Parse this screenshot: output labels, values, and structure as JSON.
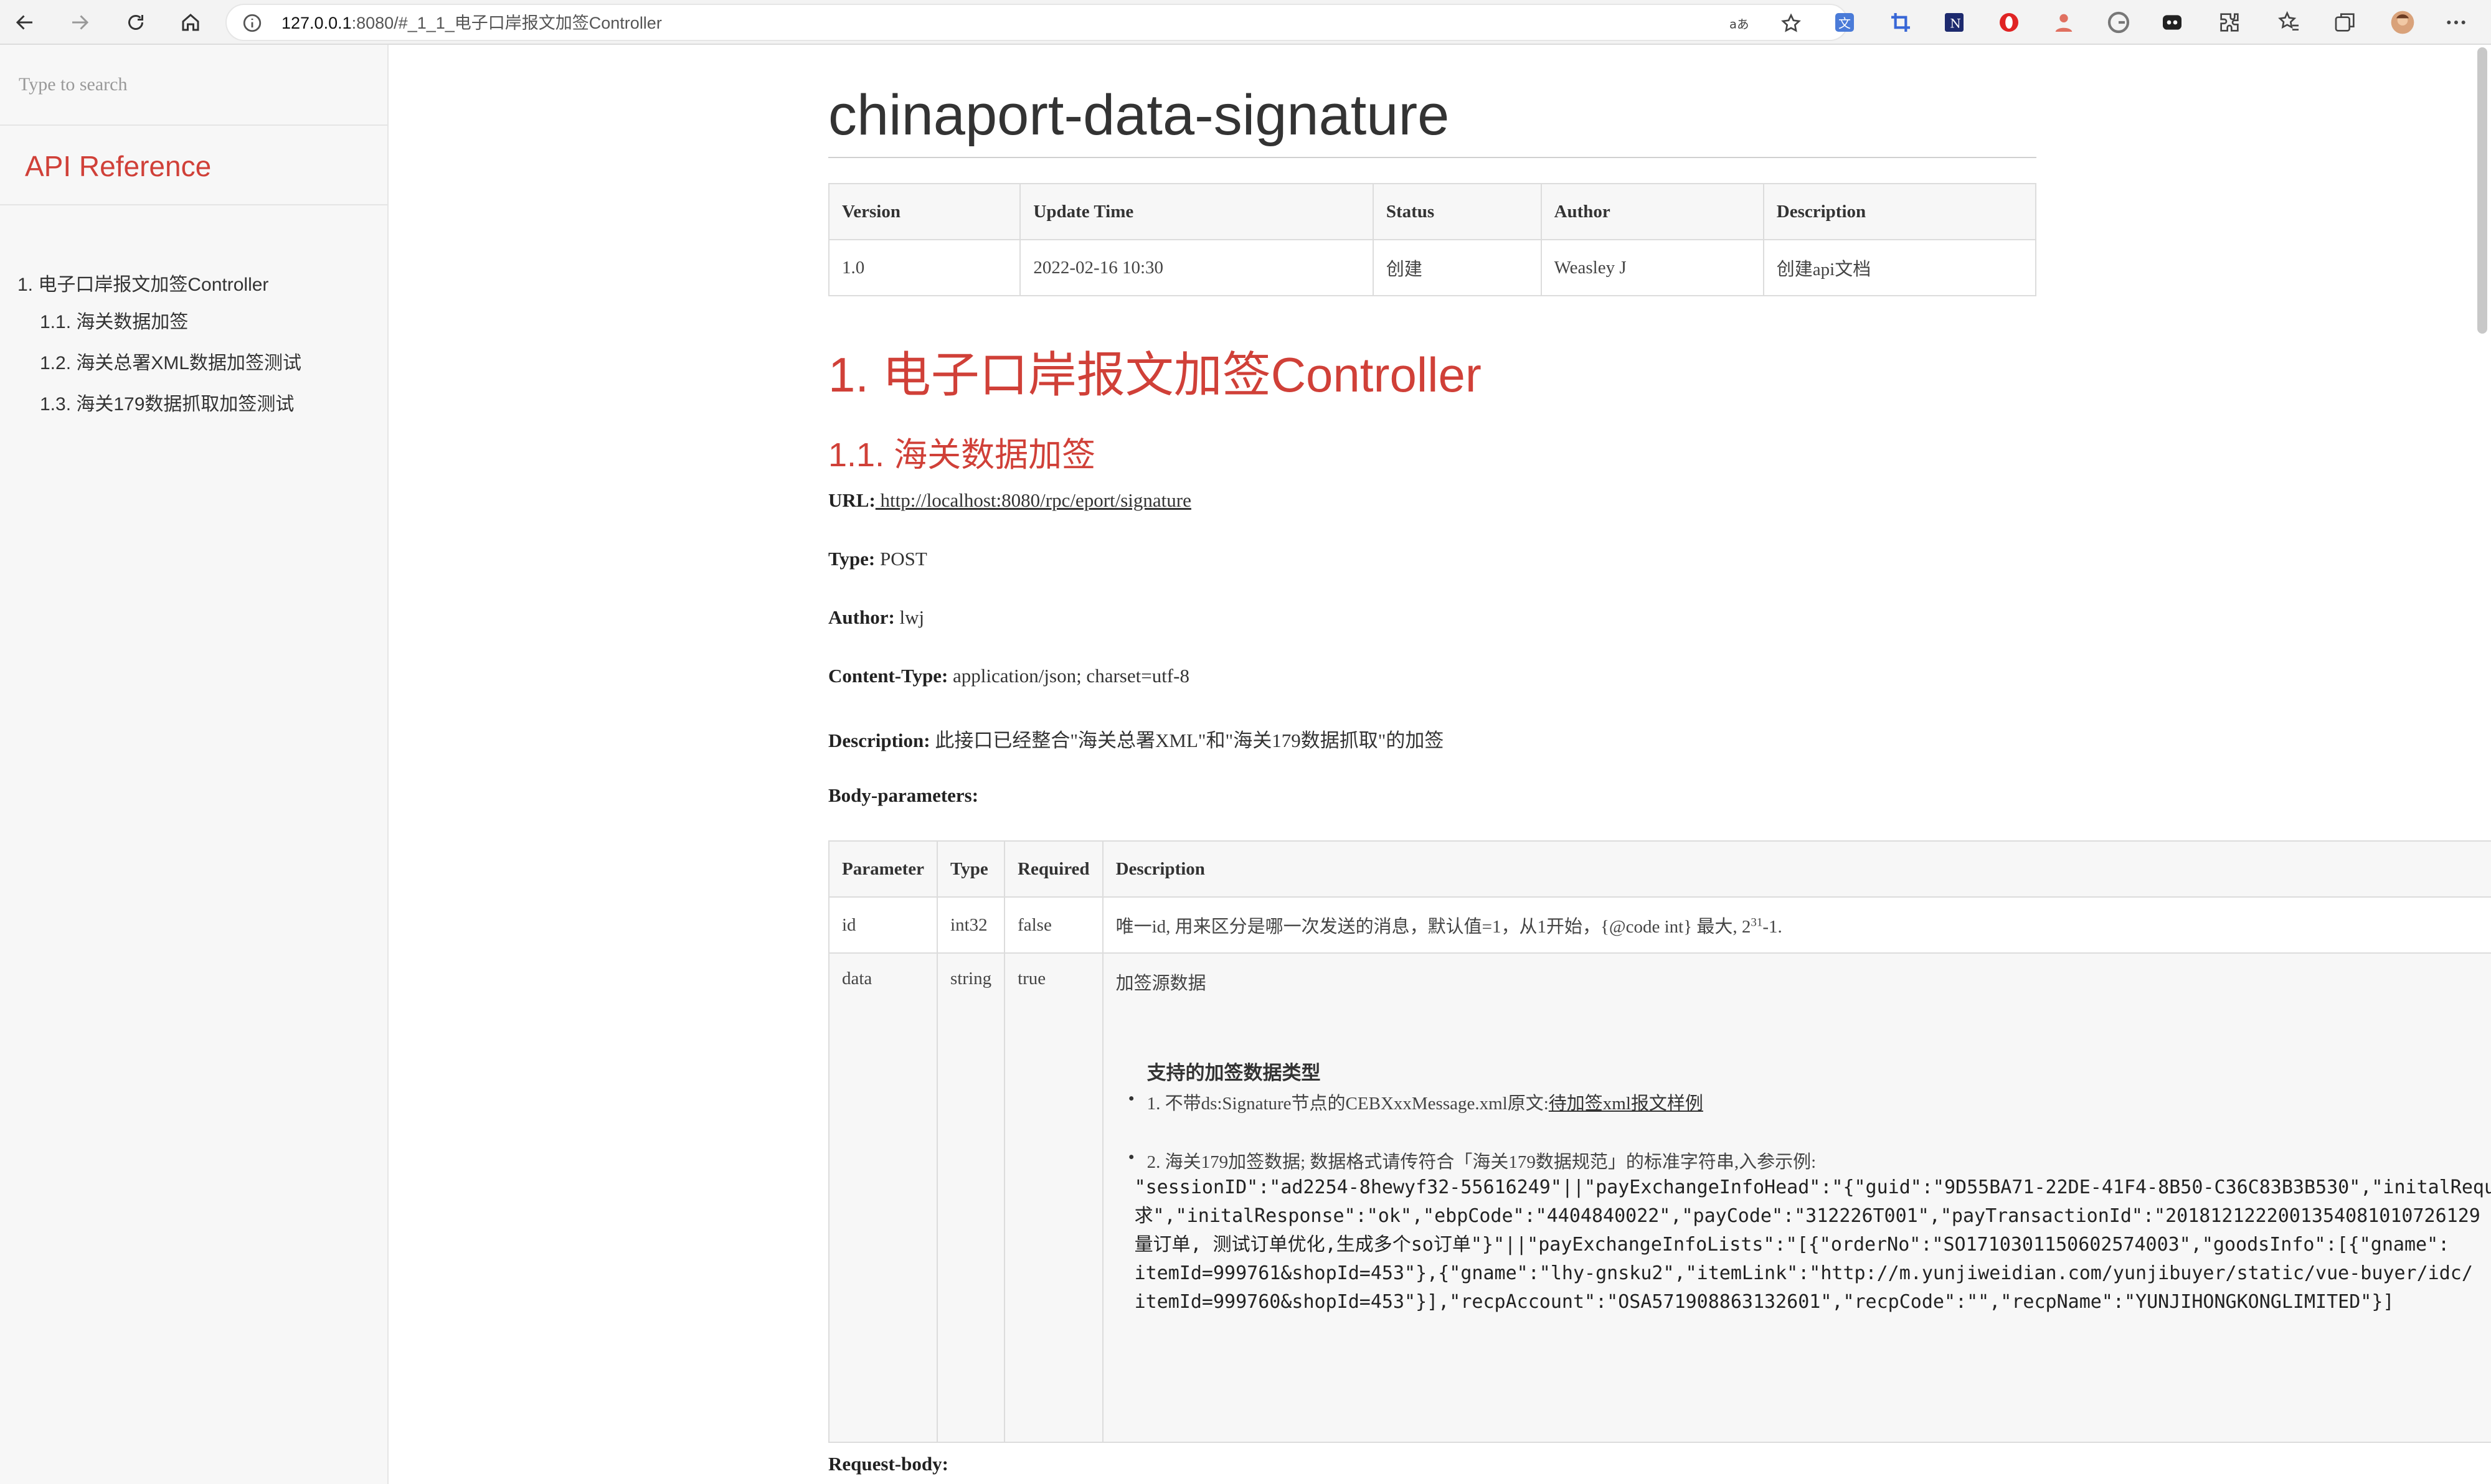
{
  "browser": {
    "url_host": "127.0.0.1",
    "url_rest": ":8080/#_1_1_电子口岸报文加签Controller"
  },
  "sidebar": {
    "search_placeholder": "Type to search",
    "heading": "API Reference",
    "items": [
      {
        "label": "1. 电子口岸报文加签Controller"
      },
      {
        "label": "1.1. 海关数据加签"
      },
      {
        "label": "1.2. 海关总署XML数据加签测试"
      },
      {
        "label": "1.3. 海关179数据抓取加签测试"
      }
    ]
  },
  "doc": {
    "title": "chinaport-data-signature",
    "version_table": {
      "headers": [
        "Version",
        "Update Time",
        "Status",
        "Author",
        "Description"
      ],
      "row": [
        "1.0",
        "2022-02-16 10:30",
        "创建",
        "Weasley J",
        "创建api文档"
      ]
    },
    "section_title": "1. 电子口岸报文加签Controller",
    "subsection_title": "1.1. 海关数据加签",
    "fields": {
      "url_label": "URL:",
      "url_value": " http://localhost:8080/rpc/eport/signature",
      "type_label": "Type:",
      "type_value": " POST",
      "author_label": "Author:",
      "author_value": " lwj",
      "content_type_label": "Content-Type:",
      "content_type_value": " application/json; charset=utf-8",
      "description_label": "Description:",
      "description_value": " 此接口已经整合\"海关总署XML\"和\"海关179数据抓取\"的加签",
      "body_params_label": "Body-parameters:",
      "request_body_label": "Request-body:"
    },
    "param_table": {
      "headers": [
        "Parameter",
        "Type",
        "Required",
        "Description"
      ],
      "rows": [
        {
          "param": "id",
          "type": "int32",
          "required": "false",
          "desc_prefix": "唯一id, 用来区分是哪一次发送的消息，默认值=1，从1开始，{@code int} 最大, 2",
          "desc_sup": "31",
          "desc_suffix": "-1."
        },
        {
          "param": "data",
          "type": "string",
          "required": "true",
          "desc_title": "加签源数据",
          "support_heading": "支持的加签数据类型",
          "bullet1_text": "1. 不带ds:Signature节点的CEBXxxMessage.xml原文:",
          "bullet1_link": "待加签xml报文样例",
          "bullet2_text": "2. 海关179加签数据; 数据格式请传符合「海关179数据规范」的标准字符串,入参示例:",
          "code_lines": [
            "\"sessionID\":\"ad2254-8hewyf32-55616249\"||\"payExchangeInfoHead\":\"{\"guid\":\"9D55BA71-22DE-41F4-8B50-C36C83B3B530\",\"initalRequest\":\"",
            "求\",\"initalResponse\":\"ok\",\"ebpCode\":\"4404840022\",\"payCode\":\"312226T001\",\"payTransactionId\":\"2018121222001354081010726129",
            "量订单, 测试订单优化,生成多个so订单\"}\"||\"payExchangeInfoLists\":\"[{\"orderNo\":\"SO1710301150602574003\",\"goodsInfo\":[{\"gname\":",
            "itemId=999761&shopId=453\"},{\"gname\":\"lhy-gnsku2\",\"itemLink\":\"http://m.yunjiweidian.com/yunjibuyer/static/vue-buyer/idc/",
            "itemId=999760&shopId=453\"}],\"recpAccount\":\"OSA571908863132601\",\"recpCode\":\"\",\"recpName\":\"YUNJIHONGKONGLIMITED\"}]"
          ]
        }
      ]
    }
  }
}
